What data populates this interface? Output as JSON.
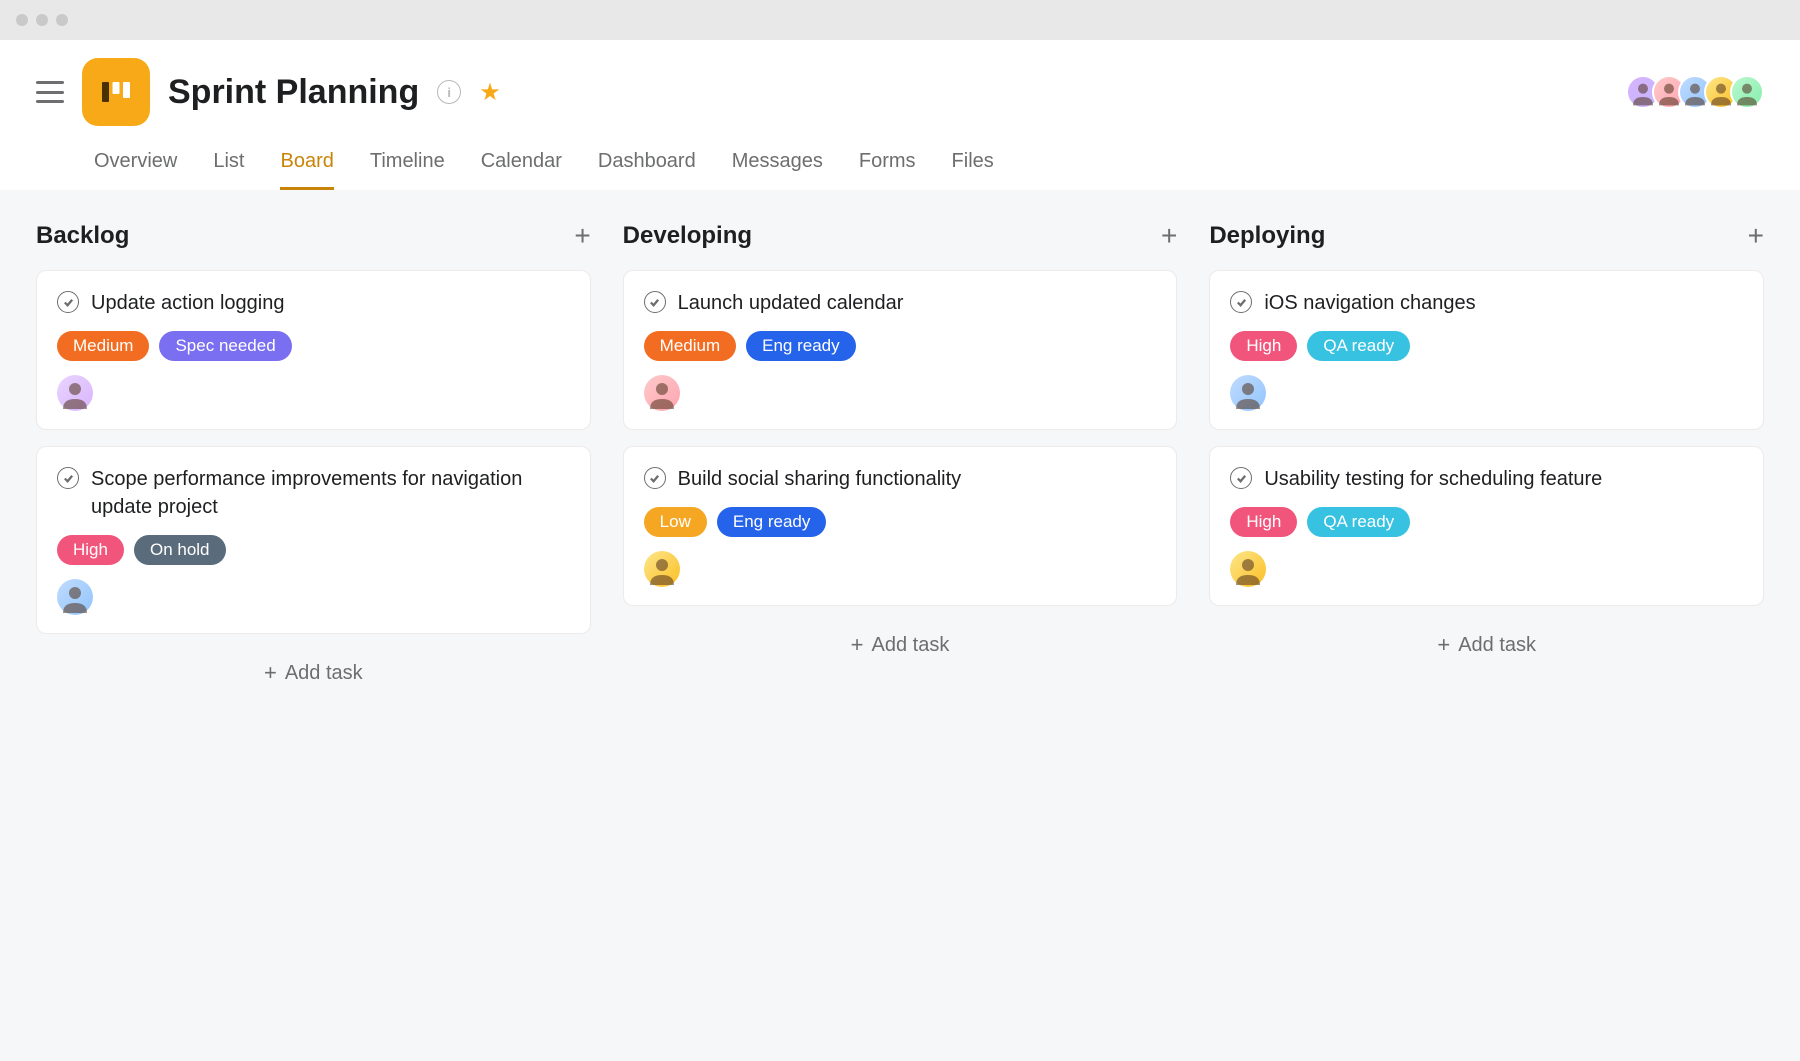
{
  "header": {
    "title": "Sprint Planning",
    "starred": true
  },
  "tabs": [
    {
      "label": "Overview",
      "active": false
    },
    {
      "label": "List",
      "active": false
    },
    {
      "label": "Board",
      "active": true
    },
    {
      "label": "Timeline",
      "active": false
    },
    {
      "label": "Calendar",
      "active": false
    },
    {
      "label": "Dashboard",
      "active": false
    },
    {
      "label": "Messages",
      "active": false
    },
    {
      "label": "Forms",
      "active": false
    },
    {
      "label": "Files",
      "active": false
    }
  ],
  "members": [
    {
      "name": "member-1",
      "class": "avatar-1"
    },
    {
      "name": "member-2",
      "class": "avatar-2"
    },
    {
      "name": "member-3",
      "class": "avatar-3"
    },
    {
      "name": "member-4",
      "class": "avatar-4"
    },
    {
      "name": "member-5",
      "class": "avatar-5"
    }
  ],
  "columns": [
    {
      "title": "Backlog",
      "cards": [
        {
          "title": "Update action logging",
          "tags": [
            {
              "label": "Medium",
              "color": "#f26d21"
            },
            {
              "label": "Spec needed",
              "color": "#7a6ff0"
            }
          ],
          "assignee_class": "avatar-6"
        },
        {
          "title": "Scope performance improvements for navigation update project",
          "tags": [
            {
              "label": "High",
              "color": "#f1557c"
            },
            {
              "label": "On hold",
              "color": "#5a6b7b"
            }
          ],
          "assignee_class": "avatar-3"
        }
      ],
      "add_label": "Add task"
    },
    {
      "title": "Developing",
      "cards": [
        {
          "title": "Launch updated calendar",
          "tags": [
            {
              "label": "Medium",
              "color": "#f26d21"
            },
            {
              "label": "Eng ready",
              "color": "#2563eb"
            }
          ],
          "assignee_class": "avatar-2"
        },
        {
          "title": "Build social sharing functionality",
          "tags": [
            {
              "label": "Low",
              "color": "#f5a623"
            },
            {
              "label": "Eng ready",
              "color": "#2563eb"
            }
          ],
          "assignee_class": "avatar-4"
        }
      ],
      "add_label": "Add task"
    },
    {
      "title": "Deploying",
      "cards": [
        {
          "title": "iOS navigation changes",
          "tags": [
            {
              "label": "High",
              "color": "#f1557c"
            },
            {
              "label": "QA ready",
              "color": "#37c2e2"
            }
          ],
          "assignee_class": "avatar-3"
        },
        {
          "title": "Usability testing for scheduling feature",
          "tags": [
            {
              "label": "High",
              "color": "#f1557c"
            },
            {
              "label": "QA ready",
              "color": "#37c2e2"
            }
          ],
          "assignee_class": "avatar-4"
        }
      ],
      "add_label": "Add task"
    }
  ]
}
